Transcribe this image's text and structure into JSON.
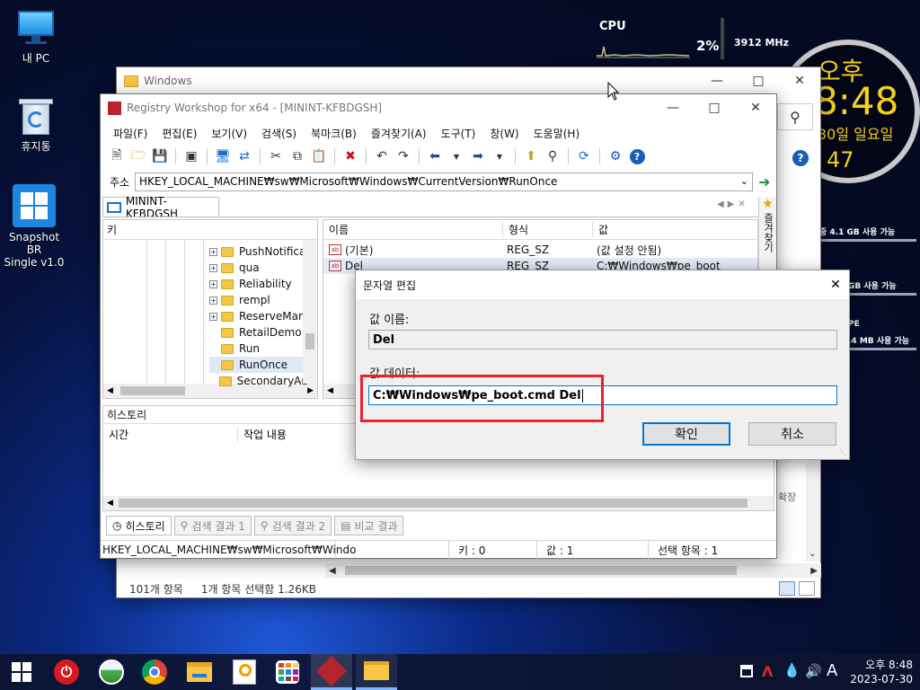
{
  "desktop": {
    "icons": [
      {
        "label": "내 PC"
      },
      {
        "label": "휴지통"
      },
      {
        "label_line1": "Snapshot BR",
        "label_line2": "Single v1.0"
      }
    ]
  },
  "gadget": {
    "cpu_label": "CPU",
    "cpu_percent": "2%",
    "cpu_freq": "3912 MHz",
    "clock_ampm": "오후",
    "clock_time": "8:48",
    "clock_date": "30일 일요일",
    "clock_seconds": "47",
    "mem1": "중  4.1 GB 사용 가능",
    "mem2": "GB 사용 가능",
    "mem3_label": "PE",
    "mem3": ".4 MB 사용 가능"
  },
  "explorer": {
    "title": "Windows",
    "status_items": "101개 항목",
    "status_selected": "1개 항목 선택함 1.26KB",
    "side_text": "확장"
  },
  "regws": {
    "title": "Registry Workshop for x64 - [MININT-KFBDGSH]",
    "menu": [
      "파일(F)",
      "편집(E)",
      "보기(V)",
      "검색(S)",
      "북마크(B)",
      "즐겨찾기(A)",
      "도구(T)",
      "창(W)",
      "도움말(H)"
    ],
    "address_label": "주소",
    "address_value": "HKEY_LOCAL_MACHINE₩sw₩Microsoft₩Windows₩CurrentVersion₩RunOnce",
    "tab_label": "MININT-KFBDGSH",
    "tree_header": "키",
    "tree_items": [
      "PushNotificat",
      "qua",
      "Reliability",
      "rempl",
      "ReserveMana",
      "RetailDemo",
      "Run",
      "RunOnce",
      "SecondaryAu"
    ],
    "list_headers": {
      "name": "이름",
      "type": "형식",
      "value": "값"
    },
    "list_rows": [
      {
        "name": "(기본)",
        "type": "REG_SZ",
        "value": "(값 설정 안됨)"
      },
      {
        "name": "Del",
        "type": "REG_SZ",
        "value": "C:₩Windows₩pe_boot"
      }
    ],
    "history_title": "히스토리",
    "history_cols": {
      "time": "시간",
      "action": "작업 내용"
    },
    "bottom_tabs": [
      "히스토리",
      "검색 결과 1",
      "검색 결과 2",
      "비교 결과"
    ],
    "status_path": "HKEY_LOCAL_MACHINE₩sw₩Microsoft₩Windo",
    "status_keys": "키 : 0",
    "status_values": "값 : 1",
    "status_selected": "선택 항목 : 1",
    "favorites_vertical": "즐겨찾기"
  },
  "dialog": {
    "title": "문자열 편집",
    "name_label": "값 이름:",
    "name_value": "Del",
    "data_label": "값 데이터:",
    "data_value": "C:₩Windows₩pe_boot.cmd Del",
    "ok_label": "확인",
    "cancel_label": "취소",
    "highlight_color": "#e8232b"
  },
  "taskbar": {
    "ime": "A",
    "time": "오후 8:48",
    "date": "2023-07-30"
  }
}
